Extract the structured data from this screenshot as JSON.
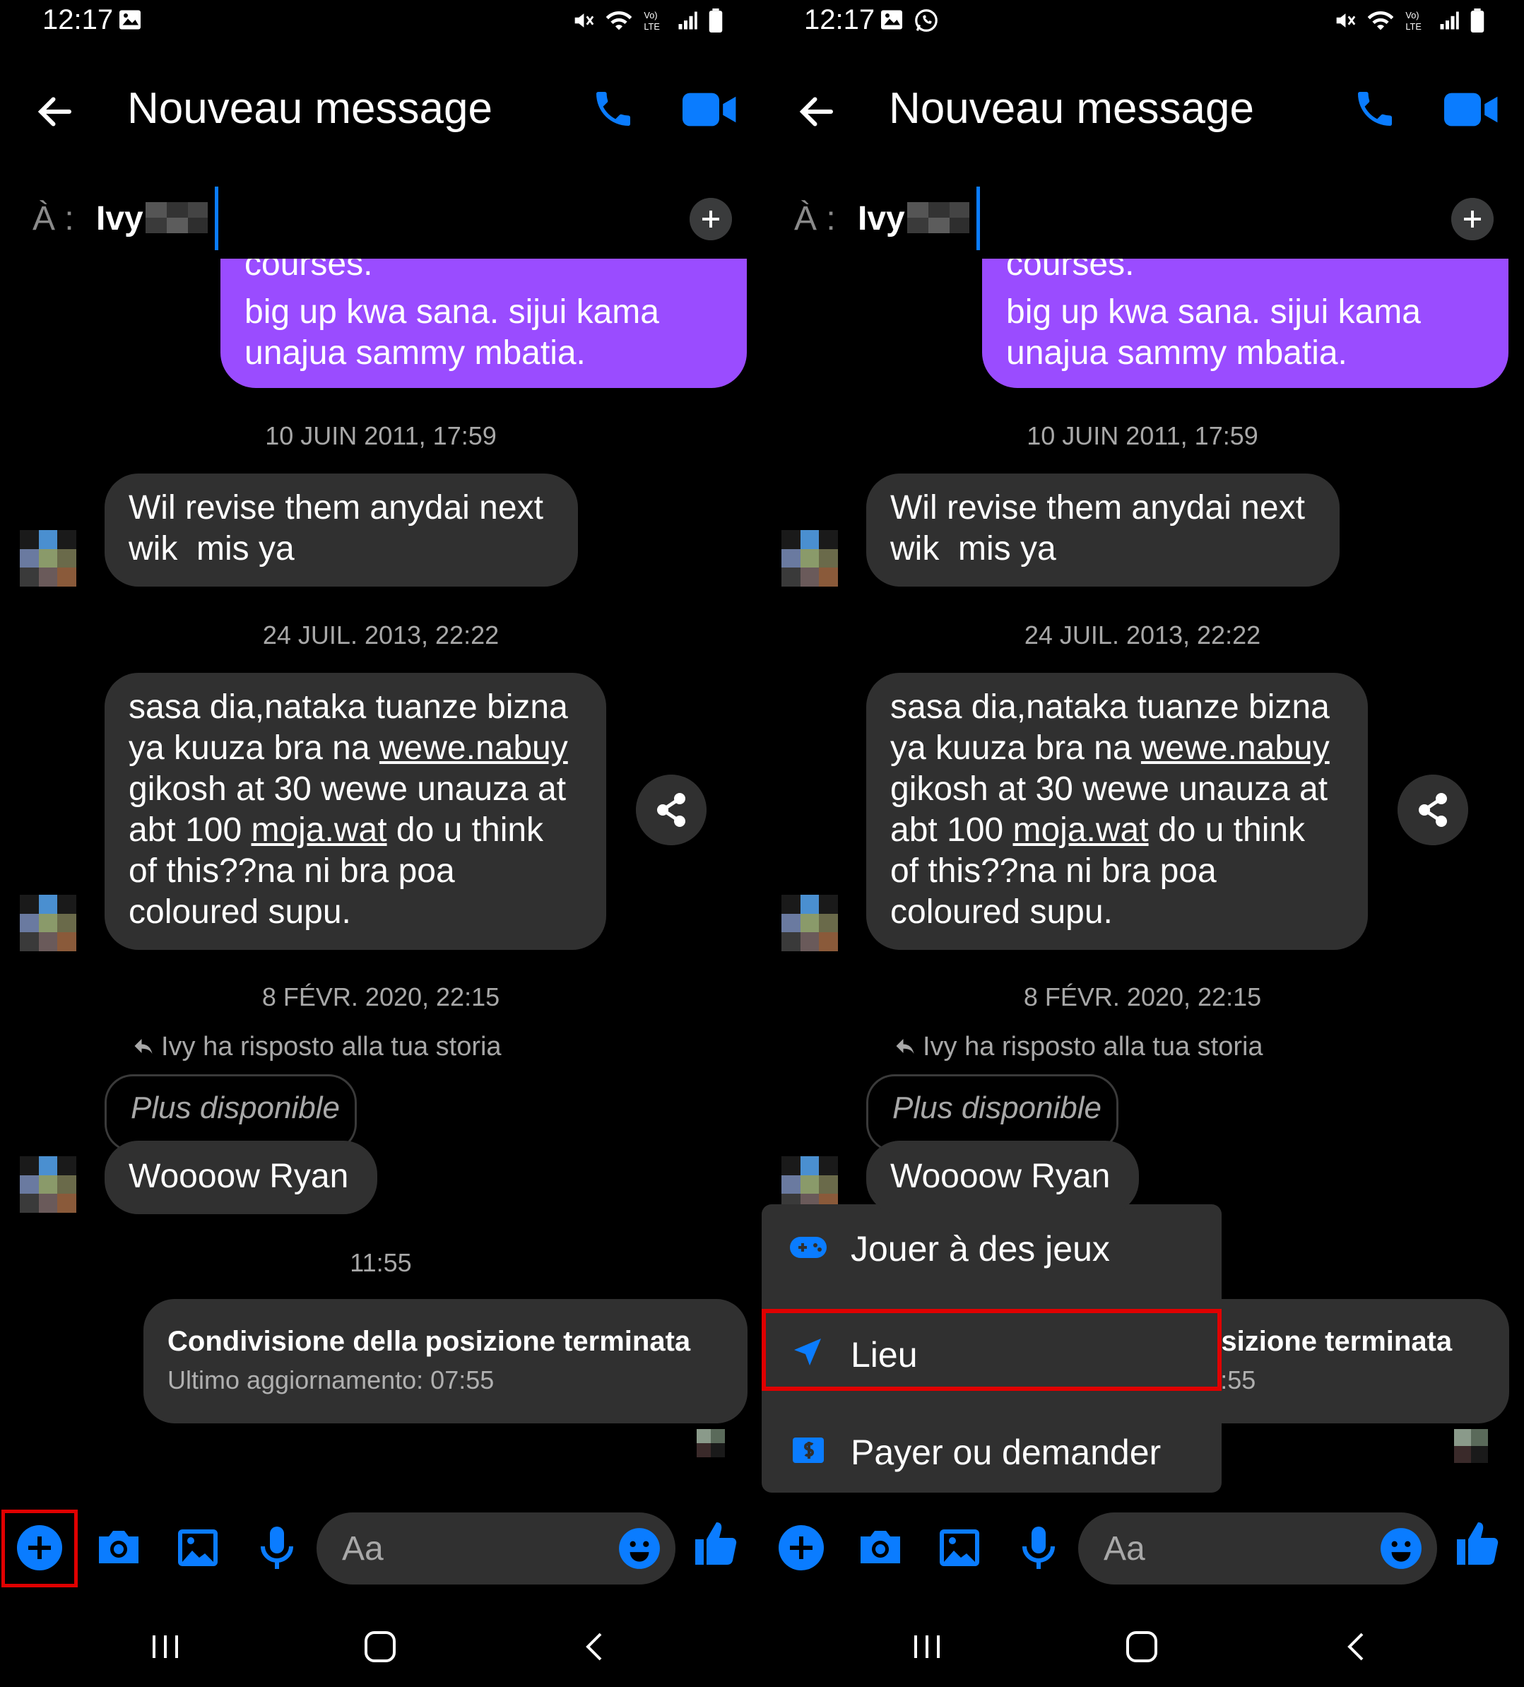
{
  "status": {
    "time": "12:17"
  },
  "header": {
    "title": "Nouveau message"
  },
  "to": {
    "label": "À :",
    "name": "Ivy"
  },
  "messages": {
    "outgoing_cut": "courses.",
    "outgoing": "big up kwa sana. sijui kama\nunajua sammy mbatia.",
    "ts1": "10 JUIN 2011, 17:59",
    "in1": "Wil revise them anydai next\nwik  mis ya",
    "ts2": "24 JUIL. 2013, 22:22",
    "in2_l1": "sasa dia,nataka tuanze bizna",
    "in2_l2a": "ya kuuza bra na ",
    "in2_l2link": "wewe.nabuy",
    "in2_l3": "gikosh at 30 wewe unauza at",
    "in2_l4a": "abt 100 ",
    "in2_l4link": "moja.wat",
    "in2_l4b": " do u think",
    "in2_l5": "of this??na ni bra poa",
    "in2_l6": "coloured supu.",
    "ts3": "8 FÉVR. 2020, 22:15",
    "reply_note": "Ivy ha risposto alla tua storia",
    "story_unavailable": "Plus disponible",
    "in3": "Woooow Ryan",
    "ts4": "11:55",
    "location_title": "Condivisione della posizione terminata",
    "location_sub": "Ultimo aggiornamento: 07:55"
  },
  "composer": {
    "placeholder": "Aa"
  },
  "popup": {
    "items": [
      {
        "label": "Jouer à des jeux",
        "icon": "gamepad-icon"
      },
      {
        "label": "Lieu",
        "icon": "location-arrow-icon"
      },
      {
        "label": "Payer ou demander",
        "icon": "dollar-icon"
      }
    ]
  },
  "colors": {
    "accent": "#0a7cff",
    "outgoing_bubble": "#9a4cff",
    "incoming_bubble": "#303030",
    "highlight": "#e00000"
  }
}
